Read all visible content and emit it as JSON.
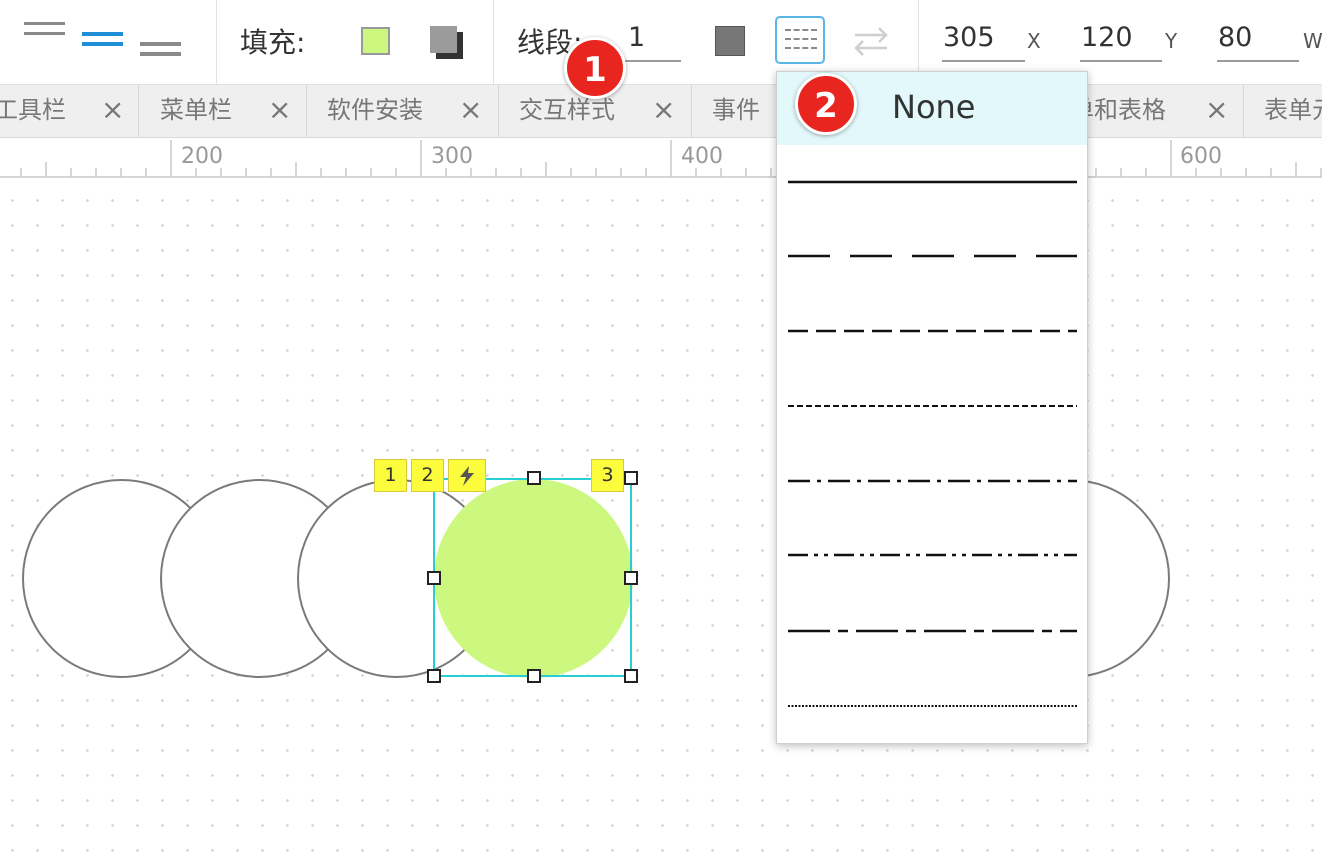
{
  "toolbar": {
    "fill_label": "填充:",
    "stroke_label": "线段:",
    "stroke_width": "1",
    "x_value": "305",
    "x_label": "X",
    "y_value": "120",
    "y_label": "Y",
    "w_value": "80",
    "w_label": "W",
    "fill_color": "#ccf87f",
    "stroke_color": "#777777",
    "line_weight_icons": [
      "line-thin-icon",
      "line-medium-icon",
      "line-thick-icon"
    ],
    "shadow_icon": "shadow-icon",
    "dash_style_icon": "dash-style-icon",
    "swap_icon": "swap-arrows-icon"
  },
  "tabs": [
    {
      "label": "工具栏",
      "close": "×"
    },
    {
      "label": "菜单栏",
      "close": "×"
    },
    {
      "label": "软件安装",
      "close": "×"
    },
    {
      "label": "交互样式",
      "close": "×"
    },
    {
      "label": "事件",
      "close": ""
    },
    {
      "label": "单和表格",
      "close": "×"
    },
    {
      "label": "表单元",
      "close": ""
    }
  ],
  "ruler": {
    "labels": [
      "200",
      "300",
      "400",
      "600"
    ]
  },
  "canvas": {
    "tags": [
      "1",
      "2",
      "3"
    ],
    "lightning_icon": "lightning-icon",
    "selected_fill": "#ccf87f",
    "selection_color": "#29cdd6"
  },
  "dropdown": {
    "selected_label": "None",
    "options": [
      "solid",
      "long-dash",
      "dash",
      "short-dash",
      "dash-dot",
      "dash-dot-dot",
      "long-dash-dot",
      "dotted"
    ]
  },
  "markers": [
    "1",
    "2"
  ]
}
